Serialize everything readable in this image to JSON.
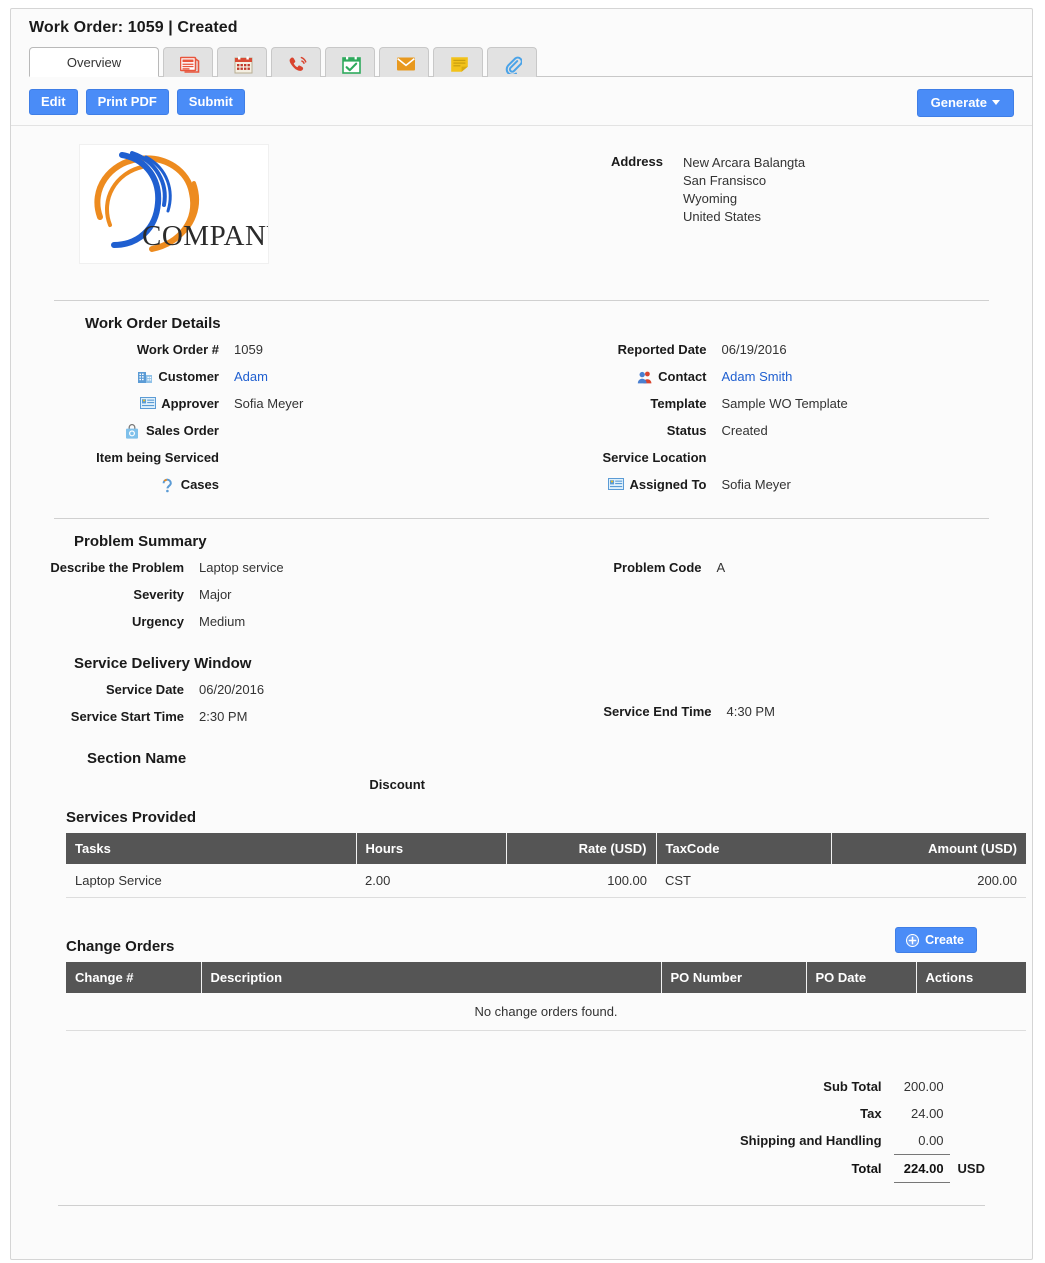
{
  "window": {
    "title": "Work Order: 1059 | Created"
  },
  "tabs": [
    {
      "label": "Overview",
      "icon": "",
      "active": true
    },
    {
      "label": "",
      "icon": "list-red-icon",
      "active": false
    },
    {
      "label": "",
      "icon": "calendar-icon",
      "active": false
    },
    {
      "label": "",
      "icon": "phone-call-icon",
      "active": false
    },
    {
      "label": "",
      "icon": "calendar-check-icon",
      "active": false
    },
    {
      "label": "",
      "icon": "envelope-icon",
      "active": false
    },
    {
      "label": "",
      "icon": "note-icon",
      "active": false
    },
    {
      "label": "",
      "icon": "paperclip-icon",
      "active": false
    }
  ],
  "toolbar": {
    "edit_label": "Edit",
    "print_pdf_label": "Print PDF",
    "submit_label": "Submit",
    "generate_label": "Generate"
  },
  "header": {
    "logo_text": "COMPANY",
    "address_label": "Address",
    "address_lines": [
      "New Arcara Balangta",
      "San Fransisco",
      "Wyoming",
      "United States"
    ]
  },
  "work_order_details": {
    "title": "Work Order Details",
    "left": [
      {
        "label": "Work Order #",
        "value": "1059",
        "icon": "",
        "link": false
      },
      {
        "label": "Customer",
        "value": "Adam",
        "icon": "building-icon",
        "link": true
      },
      {
        "label": "Approver",
        "value": "Sofia Meyer",
        "icon": "id-card-icon",
        "link": false
      },
      {
        "label": "Sales Order",
        "value": "",
        "icon": "shopping-bag-icon",
        "link": false
      },
      {
        "label": "Item being Serviced",
        "value": "",
        "icon": "",
        "link": false
      },
      {
        "label": "Cases",
        "value": "",
        "icon": "case-icon",
        "link": false
      }
    ],
    "right": [
      {
        "label": "Reported Date",
        "value": "06/19/2016",
        "icon": "",
        "link": false
      },
      {
        "label": "Contact",
        "value": "Adam Smith",
        "icon": "contact-people-icon",
        "link": true
      },
      {
        "label": "Template",
        "value": "Sample WO Template",
        "icon": "",
        "link": false
      },
      {
        "label": "Status",
        "value": "Created",
        "icon": "",
        "link": false
      },
      {
        "label": "Service Location",
        "value": "",
        "icon": "",
        "link": false
      },
      {
        "label": "Assigned To",
        "value": "Sofia Meyer",
        "icon": "id-card-icon",
        "link": false
      }
    ]
  },
  "problem_summary": {
    "title": "Problem Summary",
    "left": [
      {
        "label": "Describe the Problem",
        "value": "Laptop service"
      },
      {
        "label": "Severity",
        "value": "Major"
      },
      {
        "label": "Urgency",
        "value": "Medium"
      }
    ],
    "right": [
      {
        "label": "Problem Code",
        "value": "A"
      }
    ]
  },
  "service_delivery_window": {
    "title": "Service Delivery Window",
    "left": [
      {
        "label": "Service Date",
        "value": "06/20/2016"
      },
      {
        "label": "Service Start Time",
        "value": "2:30 PM"
      }
    ],
    "right": [
      {
        "label": "Service End Time",
        "value": "4:30 PM"
      }
    ]
  },
  "section_name": {
    "title": "Section Name",
    "discount_label": "Discount",
    "discount_value": ""
  },
  "services_provided": {
    "title": "Services Provided",
    "columns": [
      "Tasks",
      "Hours",
      "Rate (USD)",
      "TaxCode",
      "Amount (USD)"
    ],
    "rows": [
      {
        "task": "Laptop Service",
        "hours": "2.00",
        "rate": "100.00",
        "taxcode": "CST",
        "amount": "200.00"
      }
    ]
  },
  "change_orders": {
    "title": "Change Orders",
    "create_label": "Create",
    "columns": [
      "Change #",
      "Description",
      "PO Number",
      "PO Date",
      "Actions"
    ],
    "rows": [],
    "empty_message": "No change orders found."
  },
  "totals": {
    "sub_total_label": "Sub Total",
    "sub_total_value": "200.00",
    "tax_label": "Tax",
    "tax_value": "24.00",
    "shipping_label": "Shipping and Handling",
    "shipping_value": "0.00",
    "total_label": "Total",
    "total_value": "224.00",
    "currency": "USD"
  },
  "colors": {
    "accent_blue": "#4a8cf7",
    "link_blue": "#1f5fd0",
    "table_header": "#555555",
    "logo_orange": "#ed8b1f",
    "logo_blue": "#1f5fd0"
  }
}
